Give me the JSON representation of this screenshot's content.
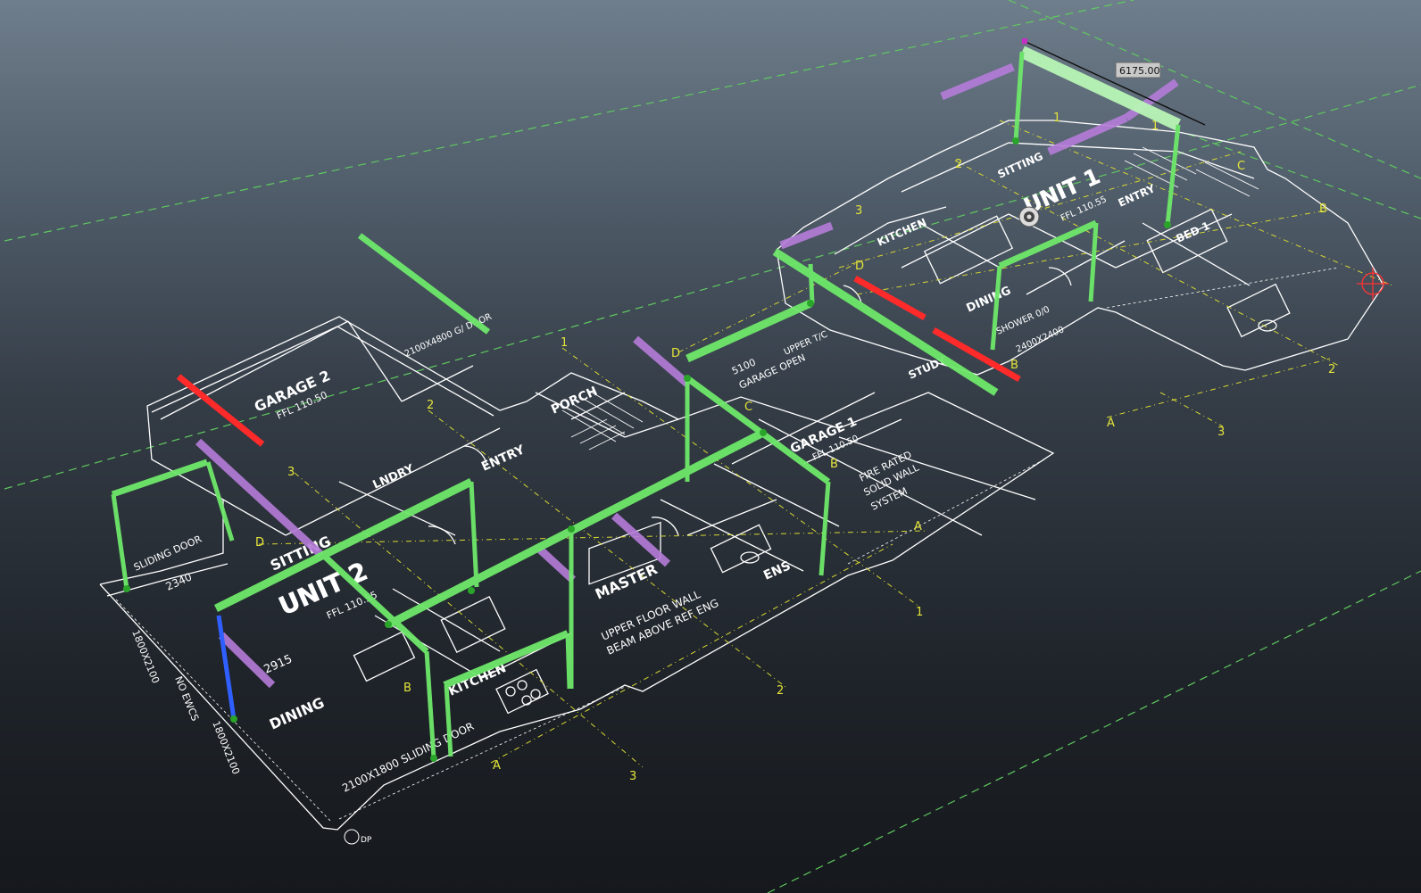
{
  "viewport": {
    "background_top": "#6f7e8c",
    "background_bottom": "#15181c"
  },
  "colors": {
    "linework": "#ffffff",
    "grid_lines": "#d8d832",
    "boundary_dashes": "#5fc95f",
    "column_green": "#6ee86a",
    "beam_red": "#ff2a2a",
    "beam_purple": "#b57cd9",
    "column_blue": "#2f5fff"
  },
  "dimension_tooltip": {
    "value": "6175.00"
  },
  "rooms": {
    "garage_2": "GARAGE 2",
    "garage_2_fl": "FFL 110.50",
    "entry": "ENTRY",
    "porch": "PORCH",
    "laundry": "LNDRY",
    "sitting_2": "SITTING",
    "unit_2": "UNIT 2",
    "unit_2_fl": "FFL 110.55",
    "dining_2": "DINING",
    "kitchen_2": "KITCHEN",
    "master": "MASTER",
    "ens": "ENS",
    "garage_1": "GARAGE 1",
    "garage_1_fl": "FFL 110.50",
    "unit_1": "UNIT 1",
    "unit_1_fl": "FFL 110.55",
    "sitting_1": "SITTING",
    "kitchen_1": "KITCHEN",
    "dining_1": "DINING",
    "entry_1": "ENTRY",
    "bed_1": "BED 1",
    "study": "STUDY"
  },
  "annotations": {
    "sliding_door_1": "SLIDING DOOR",
    "sliding_door_2": "2100X1800 SLIDING DOOR",
    "dim_2340": "2340",
    "dim_2915": "2915",
    "dim_5100": "5100",
    "garage_open": "GARAGE OPEN",
    "upper_floor_wall": "UPPER FLOOR WALL",
    "beam_above": "BEAM ABOVE REF ENG",
    "fire_rated": "FIRE RATED",
    "solid_wall": "SOLID WALL",
    "system": "SYSTEM",
    "dp": "DP",
    "window_1": "1800X2100",
    "window_2": "1800X2100",
    "no_ewcs": "NO EWCS",
    "garage_door": "2100X4800 G/ DOOR",
    "upper_tc": "UPPER T/C",
    "shower": "SHOWER 0/0",
    "dim_2400": "2400X2400"
  },
  "grid_labels": {
    "g1_left": "1",
    "g2_left": "2",
    "g3_left": "3",
    "d_left": "D",
    "b_left": "B",
    "a_left": "A",
    "b_center": "B",
    "a_center": "A",
    "g1_center": "1",
    "g2_center": "2",
    "g3_center": "3",
    "d_center": "D",
    "c_center": "C",
    "b_right_mid": "B",
    "d_right": "D",
    "b_right": "B",
    "a_right": "A",
    "c_right": "C",
    "g1_right": "1",
    "g2_right": "2",
    "g3_right": "3",
    "g2_far": "2",
    "g3_far": "3",
    "g1_top": "1"
  },
  "icons": {
    "orbit_target": "orbit-target-icon",
    "crosshair": "crosshair-icon"
  }
}
